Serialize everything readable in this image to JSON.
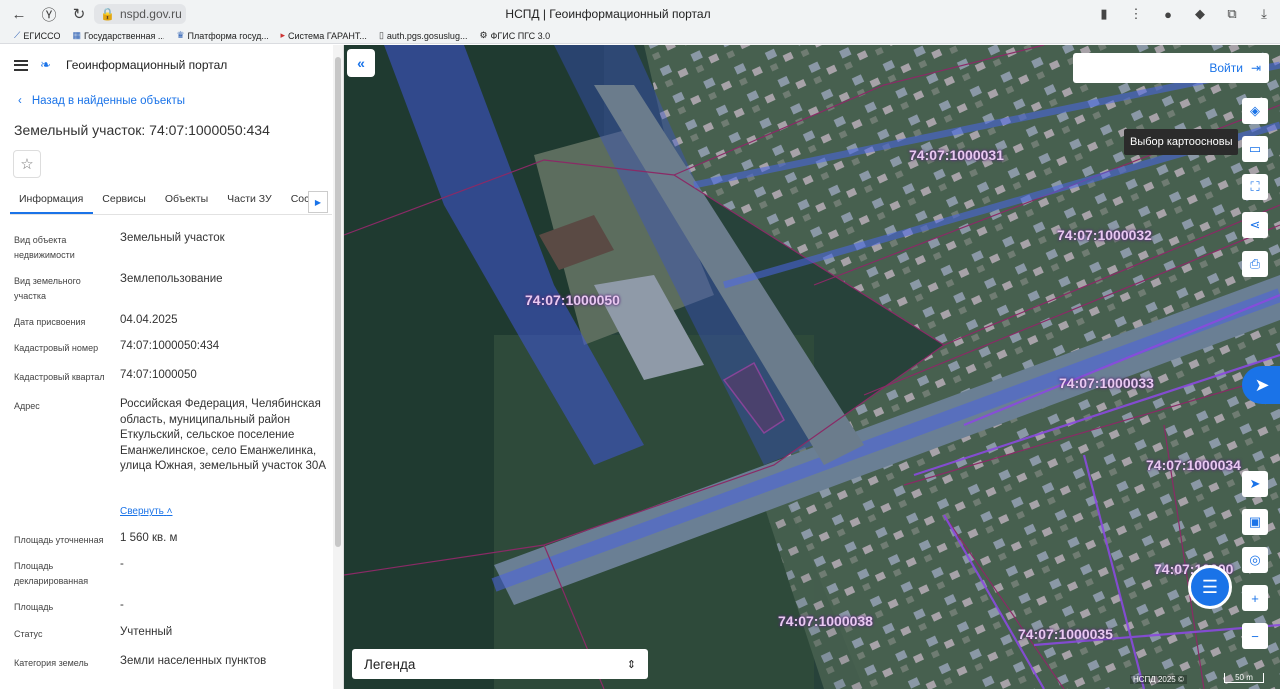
{
  "browser": {
    "url": "nspd.gov.ru",
    "page_title": "НСПД | Геоинформационный портал",
    "bookmarks": [
      "ЕГИССО",
      "Государственная ...",
      "Платформа госуд...",
      "Система ГАРАНТ...",
      "auth.pgs.gosuslug...",
      "ФГИС ПГС 3.0"
    ]
  },
  "app": {
    "title": "Геоинформационный портал"
  },
  "panel": {
    "back_label": "Назад в найденные объекты",
    "title": "Земельный участок: 74:07:1000050:434",
    "tabs": [
      "Информация",
      "Сервисы",
      "Объекты",
      "Части ЗУ",
      "Соста..."
    ],
    "properties": [
      {
        "label": "Вид объекта недвижимости",
        "value": "Земельный участок"
      },
      {
        "label": "Вид земельного участка",
        "value": "Землепользование"
      },
      {
        "label": "Дата присвоения",
        "value": "04.04.2025"
      },
      {
        "label": "Кадастровый номер",
        "value": "74:07:1000050:434"
      },
      {
        "label": "Кадастровый квартал",
        "value": "74:07:1000050"
      },
      {
        "label": "Адрес",
        "value": "Российская Федерация, Челябинская область, муниципальный район Еткульский, сельское поселение Еманжелинское, село Еманжелинка, улица Южная, земельный участок 30А"
      },
      {
        "label": "Площадь уточненная",
        "value": "1 560 кв. м"
      },
      {
        "label": "Площадь декларированная",
        "value": "-"
      },
      {
        "label": "Площадь",
        "value": "-"
      },
      {
        "label": "Статус",
        "value": "Учтенный"
      },
      {
        "label": "Категория земель",
        "value": "Земли населенных пунктов"
      }
    ],
    "collapse_label": "Свернуть"
  },
  "map": {
    "login_label": "Войти",
    "tooltip": "Выбор картоосновы",
    "legend_label": "Легенда",
    "attribution": "НСПД 2025 ©",
    "scale": "50 m",
    "quarters": [
      "74:07:1000031",
      "74:07:1000032",
      "74:07:1000050",
      "74:07:1000033",
      "74:07:1000034",
      "74:07:10000",
      "74:07:1000038",
      "74:07:1000035"
    ]
  }
}
